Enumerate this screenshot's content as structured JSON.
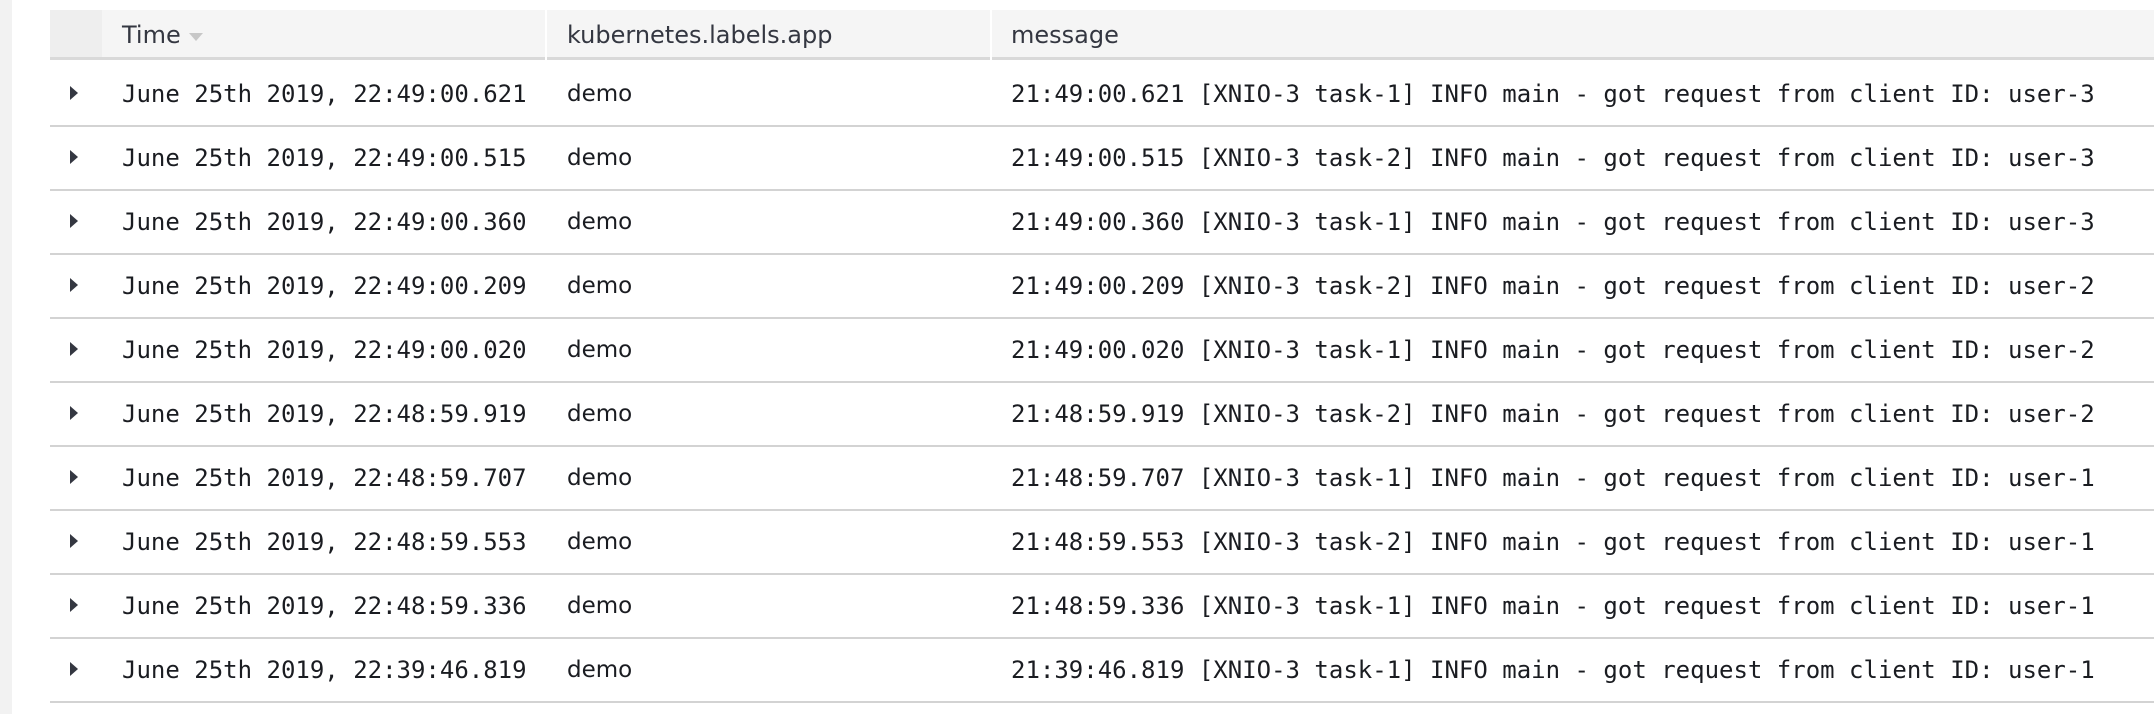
{
  "table": {
    "columns": {
      "time": "Time",
      "app": "kubernetes.labels.app",
      "message": "message"
    },
    "rows": [
      {
        "time": "June 25th 2019, 22:49:00.621",
        "app": "demo",
        "message": "21:49:00.621 [XNIO-3 task-1] INFO  main - got request from client ID: user-3"
      },
      {
        "time": "June 25th 2019, 22:49:00.515",
        "app": "demo",
        "message": "21:49:00.515 [XNIO-3 task-2] INFO  main - got request from client ID: user-3"
      },
      {
        "time": "June 25th 2019, 22:49:00.360",
        "app": "demo",
        "message": "21:49:00.360 [XNIO-3 task-1] INFO  main - got request from client ID: user-3"
      },
      {
        "time": "June 25th 2019, 22:49:00.209",
        "app": "demo",
        "message": "21:49:00.209 [XNIO-3 task-2] INFO  main - got request from client ID: user-2"
      },
      {
        "time": "June 25th 2019, 22:49:00.020",
        "app": "demo",
        "message": "21:49:00.020 [XNIO-3 task-1] INFO  main - got request from client ID: user-2"
      },
      {
        "time": "June 25th 2019, 22:48:59.919",
        "app": "demo",
        "message": "21:48:59.919 [XNIO-3 task-2] INFO  main - got request from client ID: user-2"
      },
      {
        "time": "June 25th 2019, 22:48:59.707",
        "app": "demo",
        "message": "21:48:59.707 [XNIO-3 task-1] INFO  main - got request from client ID: user-1"
      },
      {
        "time": "June 25th 2019, 22:48:59.553",
        "app": "demo",
        "message": "21:48:59.553 [XNIO-3 task-2] INFO  main - got request from client ID: user-1"
      },
      {
        "time": "June 25th 2019, 22:48:59.336",
        "app": "demo",
        "message": "21:48:59.336 [XNIO-3 task-1] INFO  main - got request from client ID: user-1"
      },
      {
        "time": "June 25th 2019, 22:39:46.819",
        "app": "demo",
        "message": "21:39:46.819 [XNIO-3 task-1] INFO  main - got request from client ID: user-1"
      }
    ]
  }
}
